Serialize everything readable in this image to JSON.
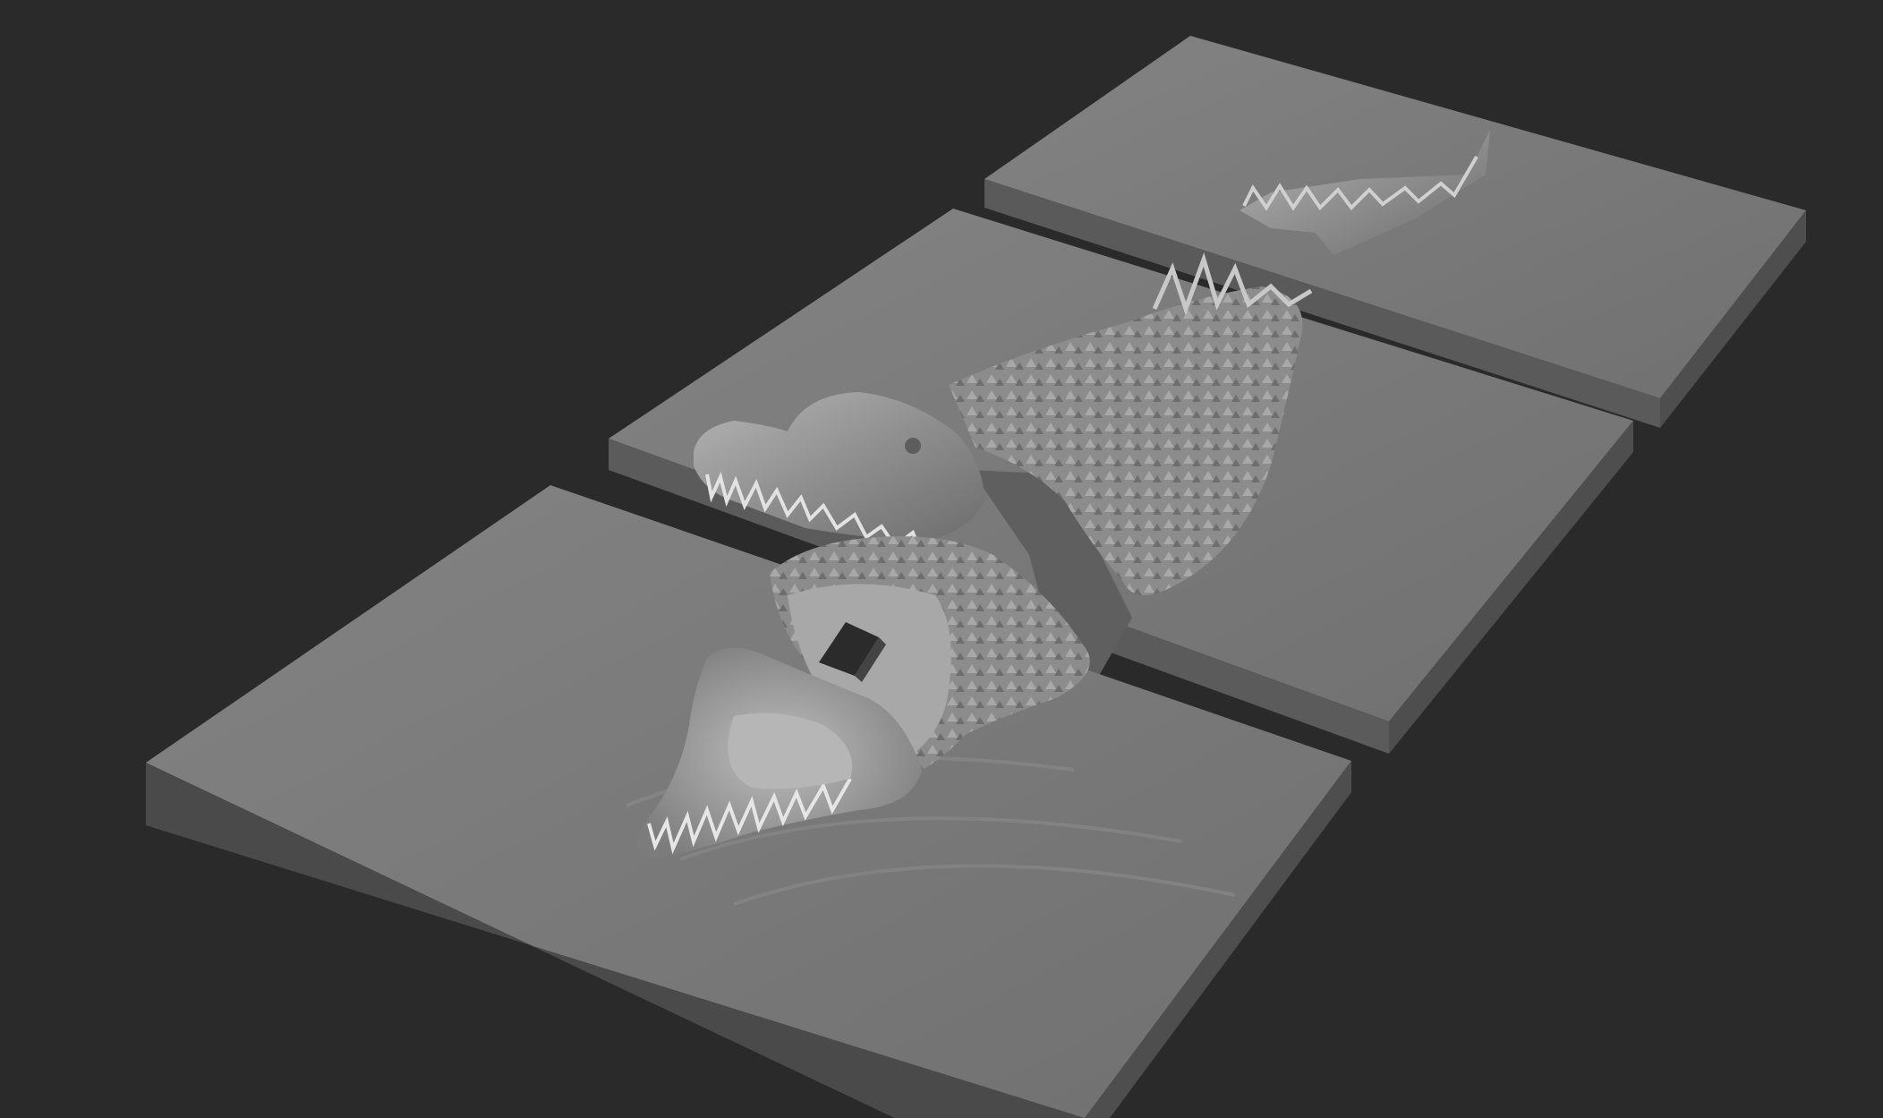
{
  "viewport": {
    "background_color": "#2a2a2a",
    "panel_top_color": "#7b7b7b",
    "panel_side_color": "#5a5a5a",
    "panel_front_color": "#4d4d4d",
    "model_color": "#9a9a9a"
  },
  "scene": {
    "panels": [
      {
        "id": "far",
        "icon": "terrain-tile-icon"
      },
      {
        "id": "middle",
        "icon": "terrain-tile-icon"
      },
      {
        "id": "near",
        "icon": "terrain-tile-icon"
      }
    ],
    "model": {
      "icon": "crocodile-sculpt-icon"
    },
    "transform_gizmo": {
      "icon": "gizmo-square-icon"
    }
  }
}
